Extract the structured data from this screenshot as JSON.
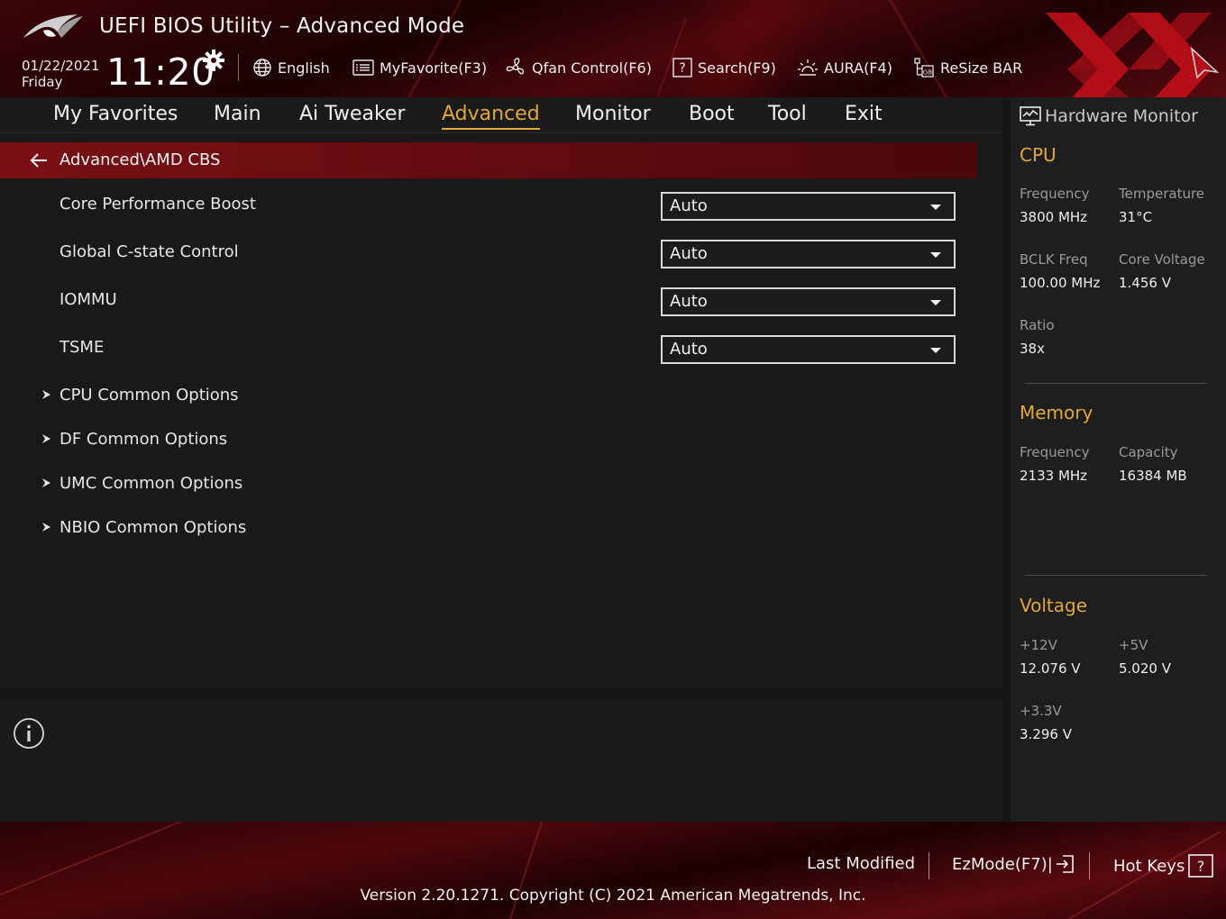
{
  "header": {
    "title": "UEFI BIOS Utility – Advanced Mode",
    "date": "01/22/2021",
    "day": "Friday",
    "time": "11:20",
    "toolbar": [
      {
        "label": "English",
        "icon": "globe-icon"
      },
      {
        "label": "MyFavorite(F3)",
        "icon": "favorite-list-icon"
      },
      {
        "label": "Qfan Control(F6)",
        "icon": "fan-icon"
      },
      {
        "label": "Search(F9)",
        "icon": "search-help-icon"
      },
      {
        "label": "AURA(F4)",
        "icon": "aura-light-icon"
      },
      {
        "label": "ReSize BAR",
        "icon": "resize-bar-icon"
      }
    ]
  },
  "menu": {
    "tabs": [
      "My Favorites",
      "Main",
      "Ai Tweaker",
      "Advanced",
      "Monitor",
      "Boot",
      "Tool",
      "Exit"
    ],
    "active": "Advanced"
  },
  "main": {
    "breadcrumb": "Advanced\\AMD CBS",
    "settings": [
      {
        "label": "Core Performance Boost",
        "value": "Auto"
      },
      {
        "label": "Global C-state Control",
        "value": "Auto"
      },
      {
        "label": "IOMMU",
        "value": "Auto"
      },
      {
        "label": "TSME",
        "value": "Auto"
      }
    ],
    "submenus": [
      "CPU Common Options",
      "DF Common Options",
      "UMC Common Options",
      "NBIO Common Options"
    ]
  },
  "hw_monitor": {
    "title": "Hardware Monitor",
    "cpu": {
      "section": "CPU",
      "frequency_label": "Frequency",
      "frequency": "3800 MHz",
      "temperature_label": "Temperature",
      "temperature": "31°C",
      "bclk_label": "BCLK Freq",
      "bclk": "100.00 MHz",
      "core_voltage_label": "Core Voltage",
      "core_voltage": "1.456 V",
      "ratio_label": "Ratio",
      "ratio": "38x"
    },
    "memory": {
      "section": "Memory",
      "frequency_label": "Frequency",
      "frequency": "2133 MHz",
      "capacity_label": "Capacity",
      "capacity": "16384 MB"
    },
    "voltage": {
      "section": "Voltage",
      "v12_label": "+12V",
      "v12": "12.076 V",
      "v5_label": "+5V",
      "v5": "5.020 V",
      "v33_label": "+3.3V",
      "v33": "3.296 V"
    }
  },
  "footer": {
    "last_modified": "Last Modified",
    "ezmode": "EzMode(F7)|",
    "hotkeys": "Hot Keys",
    "version": "Version 2.20.1271. Copyright (C) 2021 American Megatrends, Inc."
  },
  "colors": {
    "accent": "#e0a83a",
    "brand_red": "#7a1015",
    "panel": "#191919"
  }
}
